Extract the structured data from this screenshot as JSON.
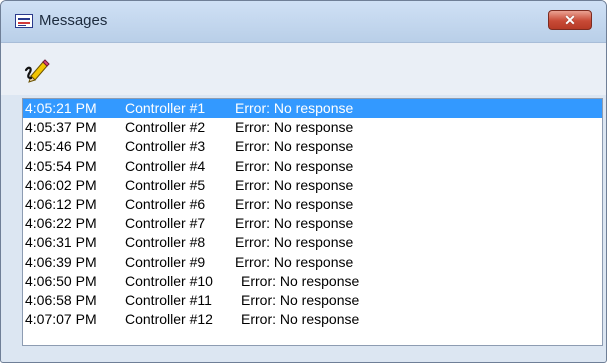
{
  "window": {
    "title": "Messages",
    "close_label": "✕"
  },
  "toolbar": {
    "clear_icon": "eraser-pencil-icon"
  },
  "colors": {
    "selection": "#3399ff",
    "close_button": "#c84a36"
  },
  "messages": [
    {
      "time": "4:05:21 PM",
      "controller": "Controller #1",
      "message": "Error: No response",
      "selected": true
    },
    {
      "time": "4:05:37 PM",
      "controller": "Controller #2",
      "message": "Error: No response"
    },
    {
      "time": "4:05:46 PM",
      "controller": "Controller #3",
      "message": "Error: No response"
    },
    {
      "time": "4:05:54 PM",
      "controller": "Controller #4",
      "message": "Error: No response"
    },
    {
      "time": "4:06:02 PM",
      "controller": "Controller #5",
      "message": "Error: No response"
    },
    {
      "time": "4:06:12 PM",
      "controller": "Controller #6",
      "message": "Error: No response"
    },
    {
      "time": "4:06:22 PM",
      "controller": "Controller #7",
      "message": "Error: No response"
    },
    {
      "time": "4:06:31 PM",
      "controller": "Controller #8",
      "message": "Error: No response"
    },
    {
      "time": "4:06:39 PM",
      "controller": "Controller #9",
      "message": "Error: No response"
    },
    {
      "time": "4:06:50 PM",
      "controller": "Controller #10",
      "message": "Error: No response"
    },
    {
      "time": "4:06:58 PM",
      "controller": "Controller #11",
      "message": "Error: No response"
    },
    {
      "time": "4:07:07 PM",
      "controller": "Controller #12",
      "message": "Error: No response"
    }
  ]
}
